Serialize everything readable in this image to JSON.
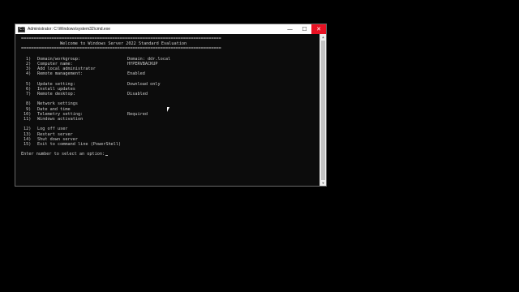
{
  "window": {
    "title": "Administrator: C:\\Windows\\system32\\cmd.exe",
    "icon_label": "C:\\",
    "min_glyph": "—",
    "max_glyph": "☐",
    "close_glyph": "✕"
  },
  "console": {
    "rule": "===============================================================================",
    "welcome": "Welcome to Windows Server 2022 Standard Evaluation",
    "menu": [
      {
        "num": "1)",
        "label": "Domain/workgroup:",
        "value": "Domain: ddr.local"
      },
      {
        "num": "2)",
        "label": "Computer name:",
        "value": "HYPERVBACKUP"
      },
      {
        "num": "3)",
        "label": "Add local administrator",
        "value": ""
      },
      {
        "num": "4)",
        "label": "Remote management:",
        "value": "Enabled"
      },
      {
        "num": "",
        "label": "",
        "value": ""
      },
      {
        "num": "5)",
        "label": "Update setting:",
        "value": "Download only"
      },
      {
        "num": "6)",
        "label": "Install updates",
        "value": ""
      },
      {
        "num": "7)",
        "label": "Remote desktop:",
        "value": "Disabled"
      },
      {
        "num": "",
        "label": "",
        "value": ""
      },
      {
        "num": "8)",
        "label": "Network settings",
        "value": ""
      },
      {
        "num": "9)",
        "label": "Date and time",
        "value": ""
      },
      {
        "num": "10)",
        "label": "Telemetry setting:",
        "value": "Required"
      },
      {
        "num": "11)",
        "label": "Windows activation",
        "value": ""
      },
      {
        "num": "",
        "label": "",
        "value": ""
      },
      {
        "num": "12)",
        "label": "Log off user",
        "value": ""
      },
      {
        "num": "13)",
        "label": "Restart server",
        "value": ""
      },
      {
        "num": "14)",
        "label": "Shut down server",
        "value": ""
      },
      {
        "num": "15)",
        "label": "Exit to command line (PowerShell)",
        "value": ""
      }
    ],
    "prompt": "Enter number to select an option:"
  },
  "colors": {
    "console_bg": "#0c0c0c",
    "console_text": "#cccccc",
    "close_button": "#e81123"
  }
}
